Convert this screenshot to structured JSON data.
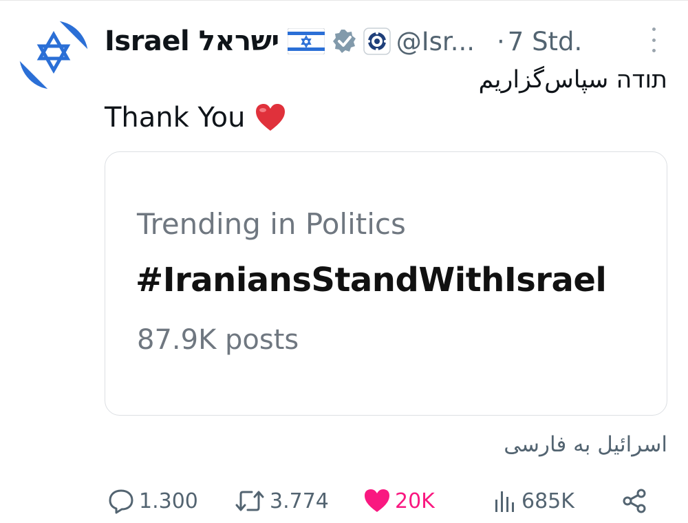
{
  "tweet": {
    "display_name": "Israel ישראל",
    "handle": "@Isr...",
    "dot": "·",
    "time": "7 Std.",
    "text_line_1": "תודה سپاس‌گزاریم",
    "text_line_2": "Thank You",
    "translation_source": "اسرائیل به فارسی"
  },
  "card": {
    "label": "Trending in Politics",
    "hashtag": "#IraniansStandWithIsrael",
    "count": "87.9K posts"
  },
  "actions": {
    "replies": "1.300",
    "reposts": "3.774",
    "likes": "20K",
    "views": "685K"
  },
  "icons": {
    "avatar": "israel-flag-avatar-icon",
    "flag": "israel-flag-icon",
    "verified": "verified-badge-icon",
    "affiliation": "affiliation-seal-icon",
    "more": "more-options-icon",
    "heart_emoji": "red-heart-emoji-icon",
    "reply": "reply-icon",
    "repost": "repost-icon",
    "like": "like-heart-icon",
    "views": "views-bar-icon",
    "share": "share-icon"
  },
  "colors": {
    "text": "#0f1419",
    "secondary": "#536471",
    "like_active": "#f91880",
    "flag_blue": "#2b6fd6",
    "card_border": "#dcdfe3"
  }
}
